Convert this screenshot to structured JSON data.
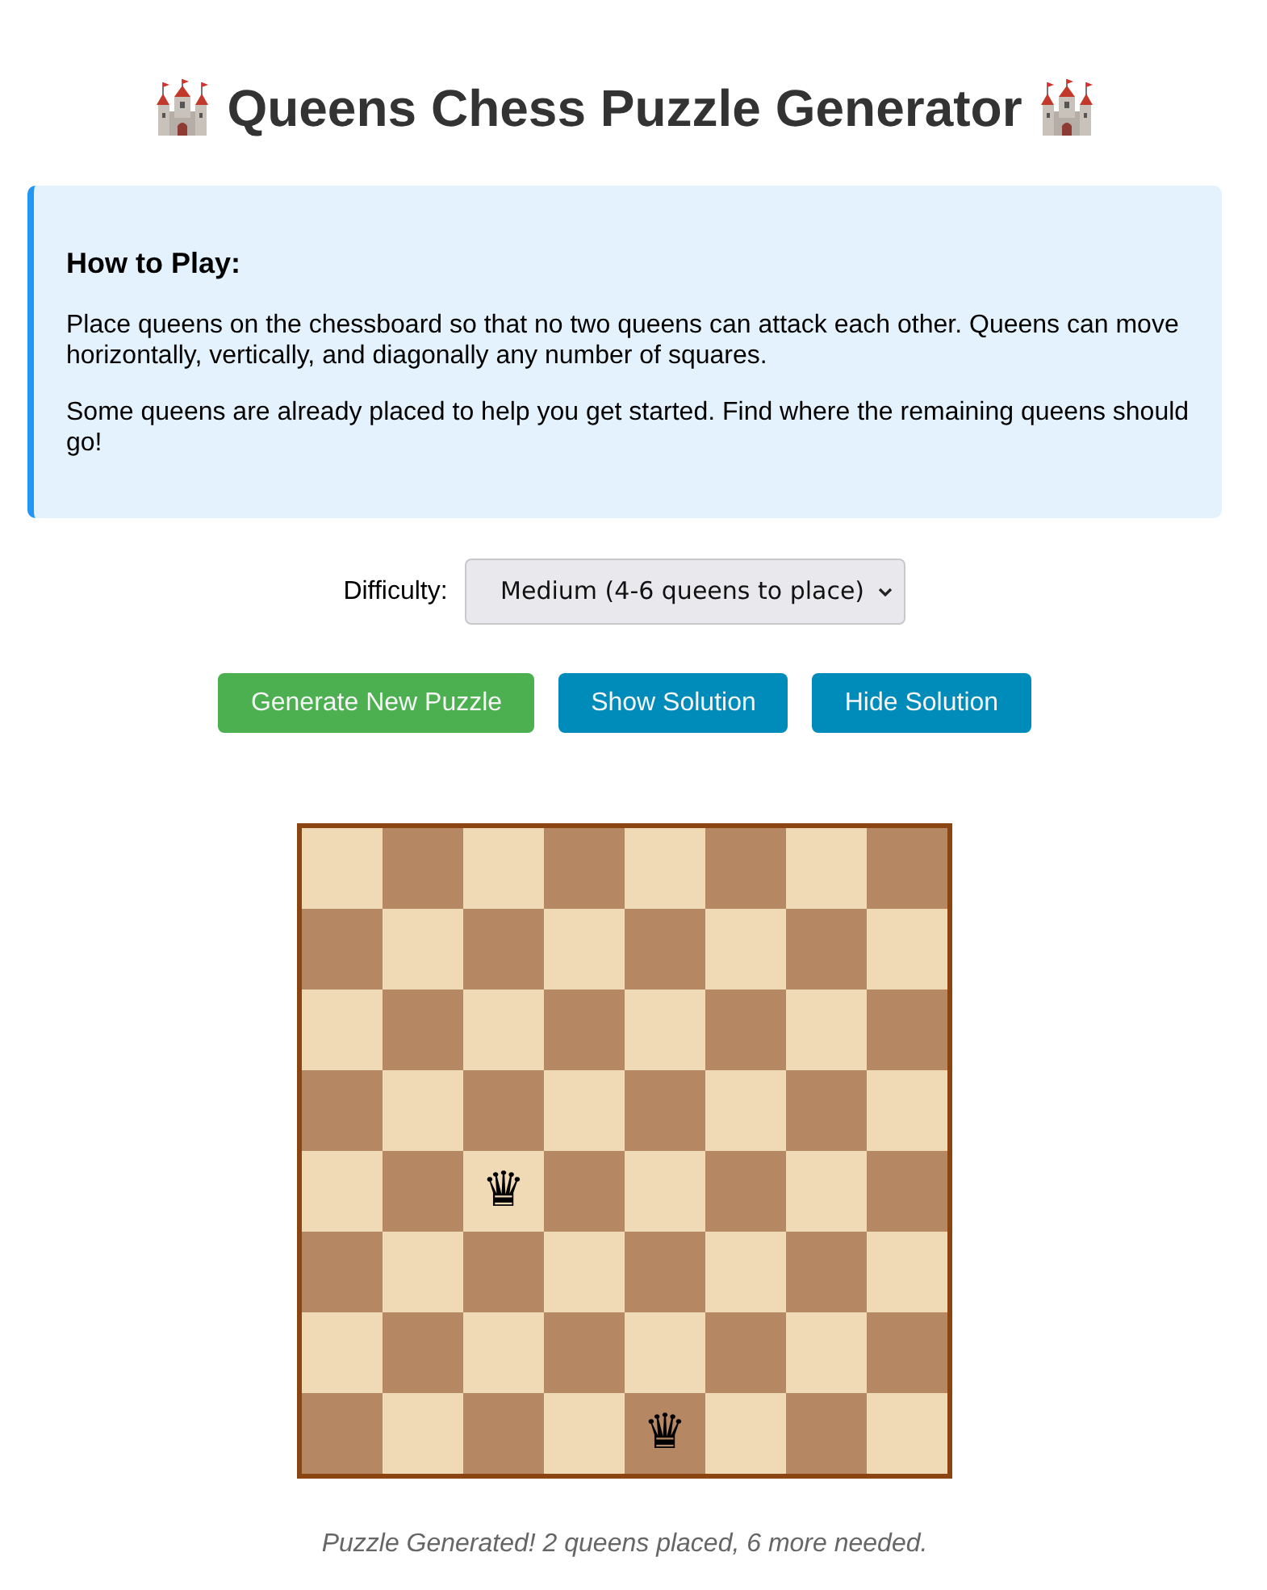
{
  "title": "Queens Chess Puzzle Generator",
  "instructions": {
    "heading": "How to Play:",
    "paragraphs": [
      "Place queens on the chessboard so that no two queens can attack each other. Queens can move horizontally, vertically, and diagonally any number of squares.",
      "Some queens are already placed to help you get started. Find where the remaining queens should go!"
    ]
  },
  "difficulty": {
    "label": "Difficulty:",
    "value": "Medium (4-6 queens to place)"
  },
  "buttons": [
    {
      "label": "Generate New Puzzle",
      "kind": "primary"
    },
    {
      "label": "Show Solution",
      "kind": "secondary"
    },
    {
      "label": "Hide Solution",
      "kind": "secondary"
    }
  ],
  "board": {
    "rows": [
      {
        "cells": [
          {
            "kind": "light"
          },
          {
            "kind": "dark"
          },
          {
            "kind": "light"
          },
          {
            "kind": "dark"
          },
          {
            "kind": "light"
          },
          {
            "kind": "dark"
          },
          {
            "kind": "light"
          },
          {
            "kind": "dark"
          }
        ]
      },
      {
        "cells": [
          {
            "kind": "dark"
          },
          {
            "kind": "light"
          },
          {
            "kind": "dark"
          },
          {
            "kind": "light"
          },
          {
            "kind": "dark"
          },
          {
            "kind": "light"
          },
          {
            "kind": "dark"
          },
          {
            "kind": "light"
          }
        ]
      },
      {
        "cells": [
          {
            "kind": "light"
          },
          {
            "kind": "dark"
          },
          {
            "kind": "light"
          },
          {
            "kind": "dark"
          },
          {
            "kind": "light"
          },
          {
            "kind": "dark"
          },
          {
            "kind": "light"
          },
          {
            "kind": "dark"
          }
        ]
      },
      {
        "cells": [
          {
            "kind": "dark"
          },
          {
            "kind": "light"
          },
          {
            "kind": "dark"
          },
          {
            "kind": "light"
          },
          {
            "kind": "dark"
          },
          {
            "kind": "light"
          },
          {
            "kind": "dark"
          },
          {
            "kind": "light"
          }
        ]
      },
      {
        "cells": [
          {
            "kind": "light"
          },
          {
            "kind": "dark"
          },
          {
            "kind": "light",
            "piece": "♛"
          },
          {
            "kind": "dark"
          },
          {
            "kind": "light"
          },
          {
            "kind": "dark"
          },
          {
            "kind": "light"
          },
          {
            "kind": "dark"
          }
        ]
      },
      {
        "cells": [
          {
            "kind": "dark"
          },
          {
            "kind": "light"
          },
          {
            "kind": "dark"
          },
          {
            "kind": "light"
          },
          {
            "kind": "dark"
          },
          {
            "kind": "light"
          },
          {
            "kind": "dark"
          },
          {
            "kind": "light"
          }
        ]
      },
      {
        "cells": [
          {
            "kind": "light"
          },
          {
            "kind": "dark"
          },
          {
            "kind": "light"
          },
          {
            "kind": "dark"
          },
          {
            "kind": "light"
          },
          {
            "kind": "dark"
          },
          {
            "kind": "light"
          },
          {
            "kind": "dark"
          }
        ]
      },
      {
        "cells": [
          {
            "kind": "dark"
          },
          {
            "kind": "light"
          },
          {
            "kind": "dark"
          },
          {
            "kind": "light"
          },
          {
            "kind": "dark",
            "piece": "♛"
          },
          {
            "kind": "light"
          },
          {
            "kind": "dark"
          },
          {
            "kind": "light"
          }
        ]
      }
    ]
  },
  "status": "Puzzle Generated! 2 queens placed, 6 more needed."
}
